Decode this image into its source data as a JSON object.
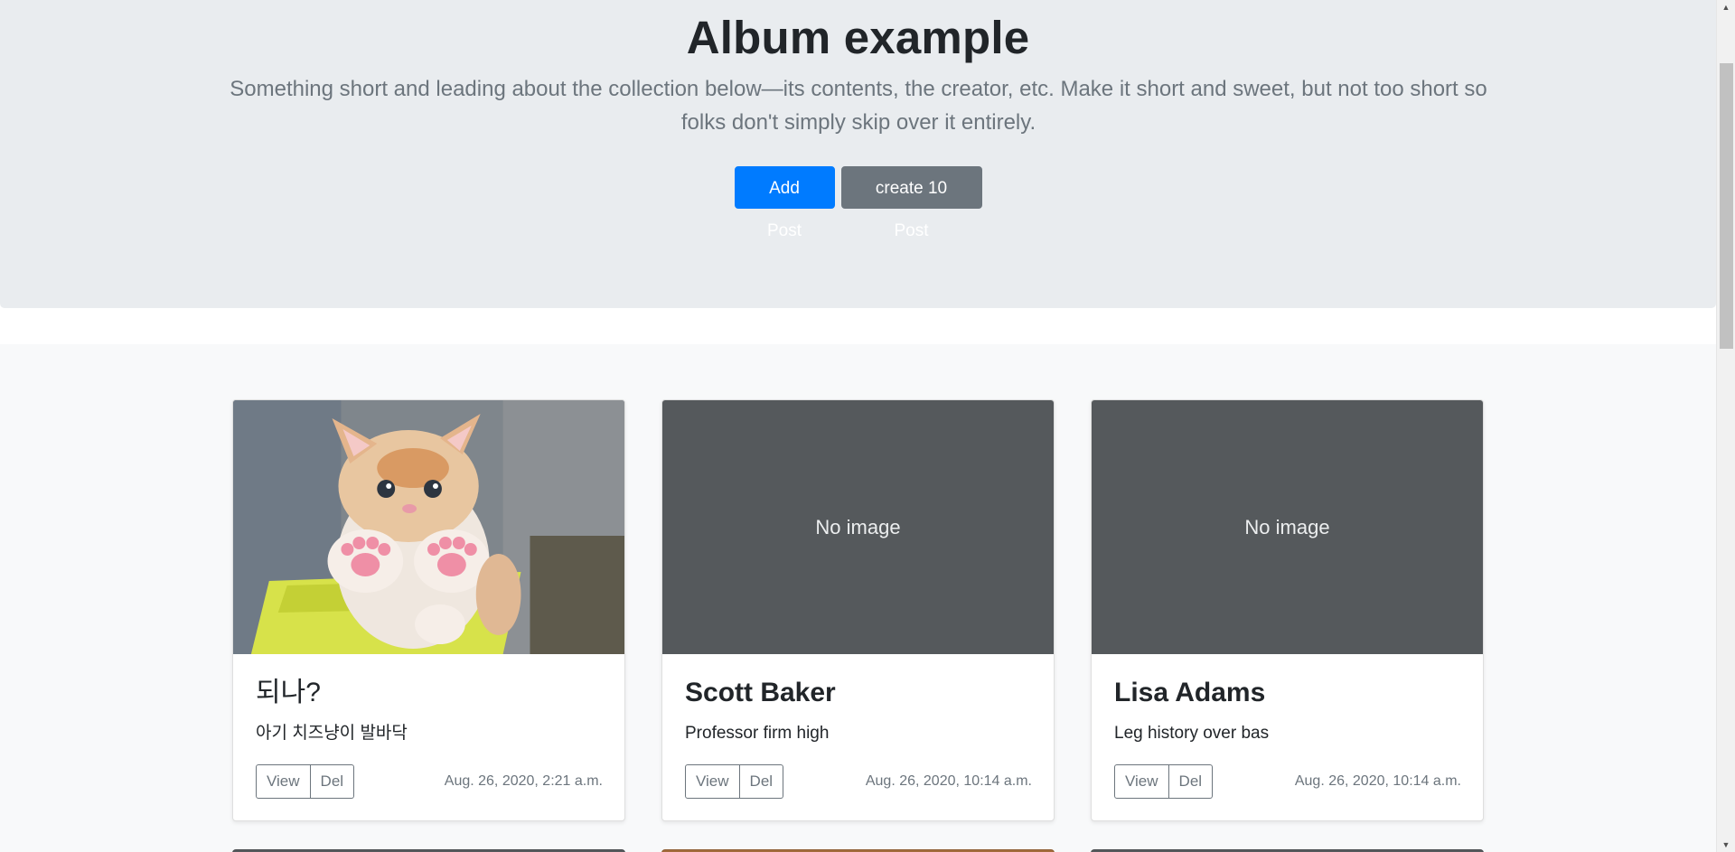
{
  "jumbotron": {
    "title": "Album example",
    "lead": "Something short and leading about the collection below—its contents, the creator, etc. Make it short and sweet, but not too short so folks don't simply skip over it entirely.",
    "primary_button": "Add Post",
    "secondary_button": "create 10 Post"
  },
  "cards": [
    {
      "image": "kitten-photo",
      "title": "되나?",
      "text": "아기 치즈냥이 발바닥",
      "view_label": "View",
      "del_label": "Del",
      "date": "Aug. 26, 2020, 2:21 a.m."
    },
    {
      "image_placeholder": "No image",
      "title": "Scott Baker",
      "text": "Professor firm high",
      "view_label": "View",
      "del_label": "Del",
      "date": "Aug. 26, 2020, 10:14 a.m."
    },
    {
      "image_placeholder": "No image",
      "title": "Lisa Adams",
      "text": "Leg history over bas",
      "view_label": "View",
      "del_label": "Del",
      "date": "Aug. 26, 2020, 10:14 a.m."
    }
  ],
  "colors": {
    "primary": "#007bff",
    "secondary": "#6c757d",
    "jumbotron_bg": "#e9ecef",
    "album_bg": "#f8f9fa",
    "placeholder_bg": "#55595c"
  }
}
